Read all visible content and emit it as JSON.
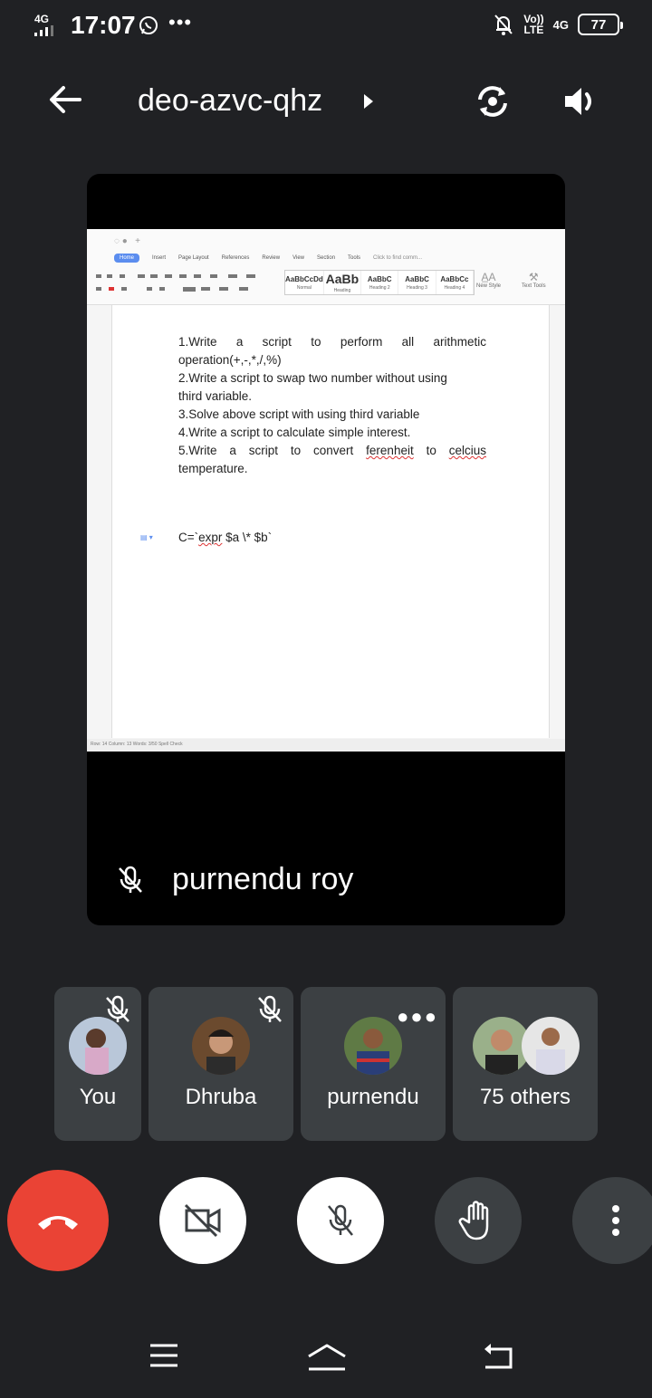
{
  "status_bar": {
    "network": "4G",
    "time": "17:07",
    "more": "•••",
    "volte": "Vo))",
    "lte": "LTE",
    "network_right": "4G",
    "battery": "77",
    "icons": [
      "signal-icon",
      "whatsapp-icon",
      "bell-off-icon",
      "battery-icon"
    ]
  },
  "header": {
    "title": "deo-azvc-qhz",
    "icons": [
      "back-arrow-icon",
      "chevron-right-icon",
      "switch-camera-icon",
      "speaker-icon"
    ]
  },
  "shared_screen": {
    "ribbon_tabs": [
      "Home",
      "Insert",
      "Page Layout",
      "References",
      "Review",
      "View",
      "Section",
      "Tools"
    ],
    "search_placeholder": "Click to find comm...",
    "styles": [
      {
        "sample": "AaBbCcDd",
        "name": "Normal"
      },
      {
        "sample": "AaBb",
        "name": "Heading"
      },
      {
        "sample": "AaBbC",
        "name": "Heading 2"
      },
      {
        "sample": "AaBbC",
        "name": "Heading 3"
      },
      {
        "sample": "AaBbCc",
        "name": "Heading 4"
      }
    ],
    "new_style": "New Style",
    "text_tools": "Text Tools",
    "document": {
      "l1a": "1.Write a script to perform all arithmetic",
      "l1b": "operation(+,-,*,/,%)",
      "l2a": "2.Write a script to swap two number without using",
      "l2b": "third variable.",
      "l3": "3.Solve above script with using third variable",
      "l4": "4.Write a script to calculate simple interest.",
      "l5a_pre": "5.Write a script to convert ",
      "l5a_w1": "ferenheit",
      "l5a_mid": " to ",
      "l5a_w2": "celcius",
      "l5b": "temperature.",
      "code_pre": "C=`",
      "code_expr": "expr",
      "code_post": " $a \\* $b`"
    },
    "status_line": "Row: 14   Column: 13     Words: 3/50    Spell Check"
  },
  "presenter": {
    "name": "purnendu roy",
    "icon": "mic-off-icon"
  },
  "participants": [
    {
      "name": "You",
      "muted": true
    },
    {
      "name": "Dhruba",
      "muted": true
    },
    {
      "name": "purnendu",
      "muted": false
    },
    {
      "name": "75 others",
      "muted": false
    }
  ],
  "controls": [
    "end-call-icon",
    "camera-off-icon",
    "mic-off-icon",
    "raise-hand-icon",
    "more-vert-icon"
  ],
  "colors": {
    "background": "#202124",
    "tile": "#3c4043",
    "end_call": "#ea4335",
    "white": "#ffffff"
  }
}
